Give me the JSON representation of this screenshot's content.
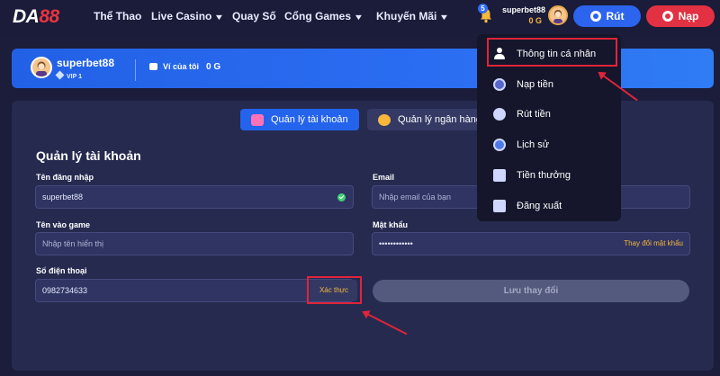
{
  "logo": {
    "part1": "DA",
    "part2": "88"
  },
  "nav": {
    "items": [
      {
        "label": "Thể Thao",
        "dropdown": false
      },
      {
        "label": "Live Casino",
        "dropdown": true
      },
      {
        "label": "Quay Số",
        "dropdown": false
      },
      {
        "label": "Cổng Games",
        "dropdown": true
      },
      {
        "label": "Khuyến Mãi",
        "dropdown": true
      }
    ],
    "chevron": "▼",
    "notification_count": "5",
    "username": "superbet88",
    "balance": "0 G",
    "withdraw_label": "Rút",
    "deposit_label": "Nạp"
  },
  "banner": {
    "username": "superbet88",
    "vip": "VIP 1",
    "wallet_label": "Ví của tôi",
    "wallet_amount": "0 G"
  },
  "tabs": {
    "account": "Quản lý tài khoản",
    "bank": "Quản lý ngân hàng"
  },
  "form": {
    "title": "Quản lý tài khoản",
    "username_label": "Tên đăng nhập",
    "username_value": "superbet88",
    "email_label": "Email",
    "email_placeholder": "Nhập email của bạn",
    "ingame_label": "Tên vào game",
    "ingame_placeholder": "Nhập tên hiển thị",
    "password_label": "Mật khẩu",
    "password_value": "••••••••••••",
    "change_password": "Thay đổi mật khẩu",
    "phone_label": "Số điện thoại",
    "phone_value": "0982734633",
    "verify_label": "Xác thực",
    "save_label": "Lưu thay đổi"
  },
  "dropdown": {
    "items": [
      {
        "label": "Thông tin cá nhân",
        "icon": "user-icon"
      },
      {
        "label": "Nạp tiền",
        "icon": "deposit-icon"
      },
      {
        "label": "Rút tiền",
        "icon": "withdraw-icon"
      },
      {
        "label": "Lịch sử",
        "icon": "history-icon"
      },
      {
        "label": "Tiền thưởng",
        "icon": "gift-icon"
      },
      {
        "label": "Đăng xuất",
        "icon": "logout-icon"
      }
    ]
  },
  "colors": {
    "background": "#1b1d3a",
    "primary_blue": "#2463ec",
    "accent_red": "#e23143",
    "gold": "#f6b73c",
    "highlight_red": "#e0243a"
  }
}
